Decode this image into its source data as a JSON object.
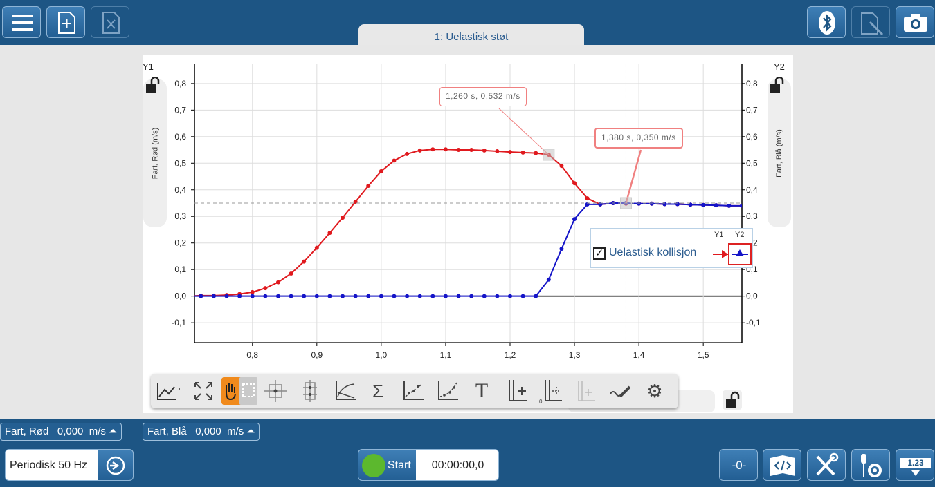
{
  "app": {
    "tab_title": "1: Uelastisk støt"
  },
  "toolbar_top": {
    "left_buttons": [
      "menu-icon",
      "new-file-icon",
      "excel-export-icon"
    ],
    "right_buttons": [
      "bluetooth-icon",
      "annotate-icon",
      "camera-icon"
    ]
  },
  "graph": {
    "y1_tag": "Y1",
    "y2_tag": "Y2",
    "y1_axis_label": "Fart, Rød (m/s)",
    "y2_axis_label": "Fart, Blå (m/s)",
    "tooltip1": "1,260 s, 0,532 m/s",
    "tooltip2": "1,380 s, 0,350 m/s",
    "legend": {
      "header_y1": "Y1",
      "header_y2": "Y2",
      "series_label": "Uelastisk kollisjon",
      "checked": true
    },
    "colors": {
      "red": "#e0191e",
      "blue": "#1414c8"
    }
  },
  "chart_data": {
    "type": "line",
    "xlim": [
      0.71,
      1.56
    ],
    "ylim": [
      -0.175,
      0.875
    ],
    "x_ticks": [
      "0,8",
      "0,9",
      "1,0",
      "1,1",
      "1,2",
      "1,3",
      "1,4",
      "1,5"
    ],
    "x_tick_values": [
      0.8,
      0.9,
      1.0,
      1.1,
      1.2,
      1.3,
      1.4,
      1.5
    ],
    "y_ticks": [
      "-0,1",
      "0,0",
      "0,1",
      "0,2",
      "0,3",
      "0,4",
      "0,5",
      "0,6",
      "0,7",
      "0,8"
    ],
    "y_tick_values": [
      -0.1,
      0.0,
      0.1,
      0.2,
      0.3,
      0.4,
      0.5,
      0.6,
      0.7,
      0.8
    ],
    "grid": true,
    "cursor": {
      "x": 1.38,
      "y": 0.35
    },
    "series": [
      {
        "name": "Fart, Rød",
        "color": "#e0191e",
        "x": [
          0.7,
          0.72,
          0.74,
          0.76,
          0.78,
          0.8,
          0.82,
          0.84,
          0.86,
          0.88,
          0.9,
          0.92,
          0.94,
          0.96,
          0.98,
          1.0,
          1.02,
          1.04,
          1.06,
          1.08,
          1.1,
          1.12,
          1.14,
          1.16,
          1.18,
          1.2,
          1.22,
          1.24,
          1.26,
          1.28,
          1.3,
          1.32,
          1.34,
          1.36,
          1.38,
          1.4,
          1.42,
          1.44,
          1.46,
          1.48,
          1.5,
          1.52,
          1.54,
          1.56
        ],
        "y": [
          0.0,
          0.002,
          0.002,
          0.004,
          0.008,
          0.015,
          0.03,
          0.052,
          0.085,
          0.13,
          0.182,
          0.238,
          0.295,
          0.355,
          0.415,
          0.47,
          0.51,
          0.535,
          0.548,
          0.552,
          0.552,
          0.55,
          0.55,
          0.548,
          0.545,
          0.542,
          0.54,
          0.538,
          0.532,
          0.49,
          0.425,
          0.368,
          0.345,
          0.35,
          0.348,
          0.348,
          0.348,
          0.346,
          0.346,
          0.344,
          0.343,
          0.342,
          0.34,
          0.34
        ]
      },
      {
        "name": "Fart, Blå",
        "color": "#1414c8",
        "x": [
          0.7,
          0.72,
          0.74,
          0.76,
          0.78,
          0.8,
          0.82,
          0.84,
          0.86,
          0.88,
          0.9,
          0.92,
          0.94,
          0.96,
          0.98,
          1.0,
          1.02,
          1.04,
          1.06,
          1.08,
          1.1,
          1.12,
          1.14,
          1.16,
          1.18,
          1.2,
          1.22,
          1.24,
          1.26,
          1.28,
          1.3,
          1.32,
          1.34,
          1.36,
          1.38,
          1.4,
          1.42,
          1.44,
          1.46,
          1.48,
          1.5,
          1.52,
          1.54,
          1.56
        ],
        "y": [
          0.0,
          0.0,
          0.0,
          0.0,
          0.0,
          0.0,
          0.0,
          0.0,
          0.0,
          0.0,
          0.0,
          0.0,
          0.0,
          0.0,
          0.0,
          0.0,
          0.0,
          0.0,
          0.0,
          0.0,
          0.0,
          0.0,
          0.0,
          0.0,
          0.0,
          0.0,
          0.0,
          0.0,
          0.062,
          0.178,
          0.29,
          0.345,
          0.345,
          0.35,
          0.35,
          0.348,
          0.348,
          0.346,
          0.346,
          0.344,
          0.343,
          0.342,
          0.34,
          0.34
        ]
      }
    ]
  },
  "graph_toolbar": {
    "tools": [
      "graph-type-icon",
      "zoom-fit-icon",
      "pan-select-icon",
      "crosshair-icon",
      "delta-icon",
      "tangent-icon",
      "sum-icon",
      "linear-fit-icon",
      "curve-fit-icon",
      "text-icon",
      "add-axis-icon",
      "add-zero-axis-icon",
      "disabled-axis-icon",
      "pen-icon",
      "settings-icon"
    ],
    "active_tool": "pan-select-icon",
    "text_tool_glyph": "T",
    "sum_glyph": "Σ",
    "gear_glyph": "⚙"
  },
  "sensors": [
    {
      "name": "Fart, Rød",
      "value": "0,000",
      "unit": "m/s"
    },
    {
      "name": "Fart, Blå",
      "value": "0,000",
      "unit": "m/s"
    }
  ],
  "bottom": {
    "sampling_mode": "Periodisk 50 Hz",
    "start_label": "Start",
    "timer": "00:00:00,0",
    "zero_label": "-0-",
    "display_value": "1.23"
  }
}
